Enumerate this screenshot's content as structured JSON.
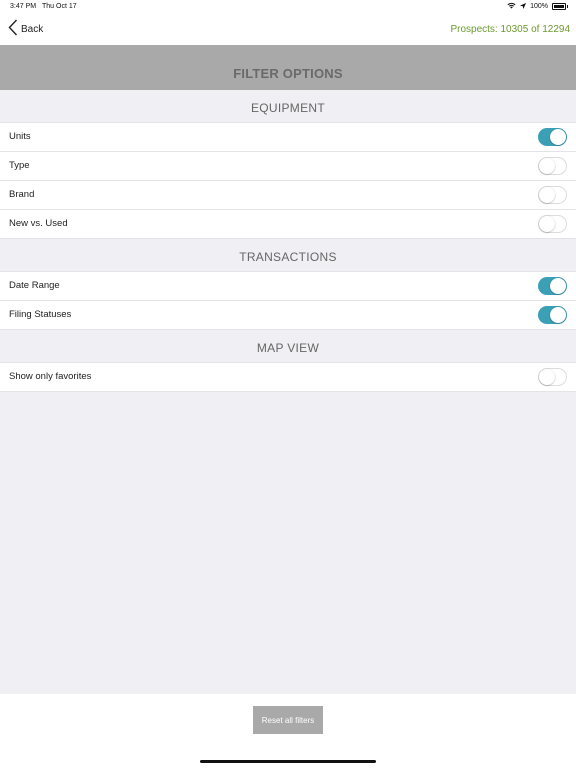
{
  "status_bar": {
    "time": "3:47 PM",
    "date": "Thu Oct 17",
    "battery": "100%",
    "icons": [
      "wifi-icon",
      "location-icon",
      "battery-icon"
    ]
  },
  "nav": {
    "back_label": "Back",
    "prospects_text": "Prospects: 10305 of 12294",
    "accent_color": "#6b9a2f"
  },
  "header": {
    "title": "FILTER OPTIONS"
  },
  "sections": [
    {
      "title": "EQUIPMENT",
      "rows": [
        {
          "label": "Units",
          "on": true
        },
        {
          "label": "Type",
          "on": false
        },
        {
          "label": "Brand",
          "on": false
        },
        {
          "label": "New vs. Used",
          "on": false
        }
      ]
    },
    {
      "title": "TRANSACTIONS",
      "rows": [
        {
          "label": "Date Range",
          "on": true
        },
        {
          "label": "Filing Statuses",
          "on": true
        }
      ]
    },
    {
      "title": "MAP VIEW",
      "rows": [
        {
          "label": "Show only favorites",
          "on": false
        }
      ]
    }
  ],
  "footer": {
    "reset_label": "Reset all filters"
  },
  "colors": {
    "toggle_on": "#3b9fb6",
    "header_bg": "#a9a9a9",
    "page_bg": "#efeff4"
  }
}
